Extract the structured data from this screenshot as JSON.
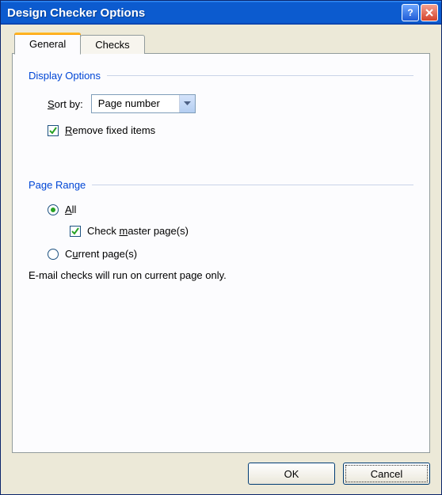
{
  "title": "Design Checker Options",
  "tabs": [
    {
      "label": "General",
      "active": true
    },
    {
      "label": "Checks",
      "active": false
    }
  ],
  "group_display": {
    "label": "Display Options",
    "sort_by_label_pre": "S",
    "sort_by_label_post": "ort by:",
    "sort_by_value": "Page number",
    "remove_fixed_pre": "R",
    "remove_fixed_post": "emove fixed items",
    "remove_fixed_checked": true
  },
  "group_range": {
    "label": "Page Range",
    "all_pre": "A",
    "all_post": "ll",
    "all_selected": true,
    "master_pre": "Check ",
    "master_u": "m",
    "master_post": "aster page(s)",
    "master_checked": true,
    "current_pre": "C",
    "current_u": "u",
    "current_post": "rrent page(s)",
    "current_selected": false
  },
  "info": "E-mail checks will run on current page only.",
  "buttons": {
    "ok": "OK",
    "cancel": "Cancel"
  }
}
